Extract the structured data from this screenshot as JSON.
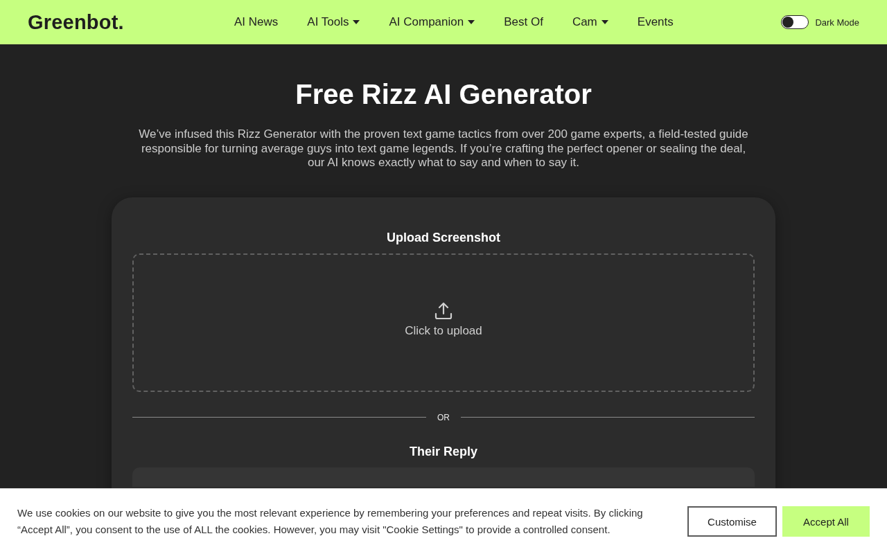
{
  "header": {
    "logo": "Greenbot.",
    "nav": [
      {
        "label": "AI News",
        "dropdown": false
      },
      {
        "label": "AI Tools",
        "dropdown": true
      },
      {
        "label": "AI Companion",
        "dropdown": true
      },
      {
        "label": "Best Of",
        "dropdown": false
      },
      {
        "label": "Cam",
        "dropdown": true
      },
      {
        "label": "Events",
        "dropdown": false
      }
    ],
    "dark_mode": {
      "label": "Dark Mode",
      "on": false
    }
  },
  "hero": {
    "title": "Free Rizz AI Generator",
    "intro": "We’ve infused this Rizz Generator with the proven text game tactics from over 200 game experts, a field-tested guide responsible for turning average guys into text game legends. If you’re crafting the perfect opener or sealing the deal, our AI knows exactly what to say and when to say it."
  },
  "generator": {
    "upload": {
      "heading": "Upload Screenshot",
      "action": "Click to upload"
    },
    "divider": "OR",
    "reply": {
      "heading": "Their Reply"
    }
  },
  "cookie_banner": {
    "text": "We use cookies on our website to give you the most relevant experience by remembering your preferences and repeat visits. By clicking “Accept All”, you consent to the use of ALL the cookies. However, you may visit \"Cookie Settings\" to provide a controlled consent.",
    "buttons": [
      {
        "label": "Customise",
        "kind": "outline"
      },
      {
        "label": "Accept All",
        "kind": "primary"
      }
    ]
  }
}
